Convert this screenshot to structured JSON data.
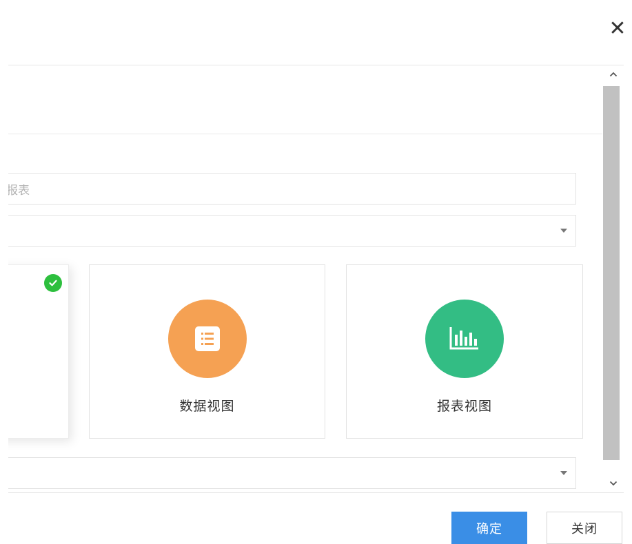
{
  "dialog": {
    "close_icon": "close-icon",
    "close_glyph": "✕"
  },
  "form": {
    "name_input": {
      "value": "",
      "placeholder": "-报表"
    },
    "type_select": {
      "value": ""
    },
    "second_select": {
      "value": ""
    }
  },
  "view_types": [
    {
      "label": "",
      "selected": true,
      "icon": "check-circle-icon"
    },
    {
      "label": "数据视图",
      "selected": false,
      "icon": "list-document-icon",
      "color": "#f5a153"
    },
    {
      "label": "报表视图",
      "selected": false,
      "icon": "bar-chart-icon",
      "color": "#33bd84"
    }
  ],
  "footer": {
    "confirm_label": "确定",
    "close_label": "关闭"
  },
  "colors": {
    "primary": "#3a8ee6",
    "selected_check": "#2dbf3e"
  }
}
